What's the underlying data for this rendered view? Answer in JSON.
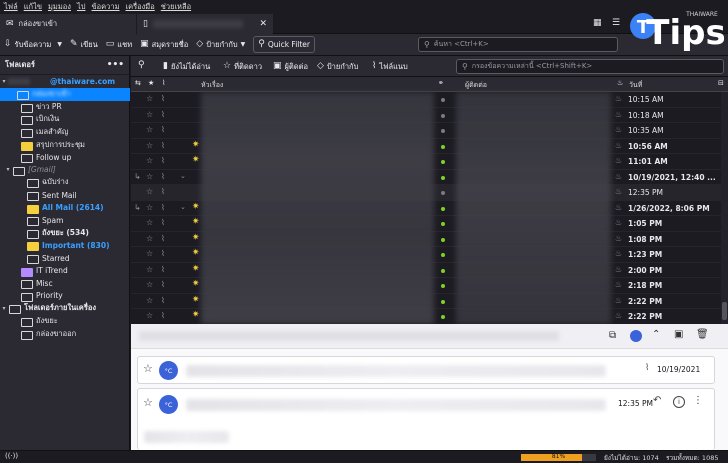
{
  "menubar": {
    "items": [
      "ไฟล์",
      "แก้ไข",
      "มุมมอง",
      "ไป",
      "ข้อความ",
      "เครื่องมือ",
      "ช่วยเหลือ"
    ]
  },
  "tabs": {
    "inbox": "กล่องขาเข้า"
  },
  "toolbar": {
    "get_messages": "รับข้อความ",
    "write": "เขียน",
    "chat": "แชท",
    "address_book": "สมุดรายชื่อ",
    "tag": "ป้ายกำกับ",
    "quick_filter": "Quick Filter",
    "search_placeholder": "ค้นหา <Ctrl+K>"
  },
  "logo": {
    "text": "Tips",
    "sub": "THAIWARE"
  },
  "sidebar": {
    "header": "โฟลเดอร์",
    "account": "@thaiware.com",
    "folders": [
      "กล่องขาเข้า",
      "ข่าว PR",
      "เบิกเงิน",
      "เมลสำคัญ",
      "สรุปการประชุม",
      "Follow up",
      "[Gmail]",
      "ฉบับร่าง",
      "Sent Mail",
      "All Mail (2614)",
      "Spam",
      "ถังขยะ (534)",
      "Important (830)",
      "Starred",
      "IT iTrend",
      "Misc",
      "Priority",
      "โฟลเดอร์ภายในเครื่อง",
      "ถังขยะ",
      "กล่องขาออก"
    ]
  },
  "quickfilter": {
    "unread": "ยังไม่ได้อ่าน",
    "starred": "ที่ติดดาว",
    "contact": "ผู้ติดต่อ",
    "tags": "ป้ายกำกับ",
    "attachment": "ไฟล์แนบ",
    "filter_placeholder": "กรองข้อความเหล่านี้ <Ctrl+Shift+K>"
  },
  "columns": {
    "subject": "หัวเรื่อง",
    "correspondents": "ผู้ติดต่อ",
    "date": "วันที่"
  },
  "messages": [
    {
      "date": "10:15 AM"
    },
    {
      "date": "10:18 AM"
    },
    {
      "date": "10:35 AM"
    },
    {
      "date": "10:56 AM"
    },
    {
      "date": "11:01 AM"
    },
    {
      "date": "10/19/2021, 12:40 ..."
    },
    {
      "date": "12:35 PM"
    },
    {
      "date": "1/26/2022, 8:06 PM"
    },
    {
      "date": "1:05 PM"
    },
    {
      "date": "1:08 PM"
    },
    {
      "date": "1:23 PM"
    },
    {
      "date": "2:00 PM"
    },
    {
      "date": "2:18 PM"
    },
    {
      "date": "2:22 PM"
    },
    {
      "date": "2:22 PM"
    }
  ],
  "reader": {
    "avatar1": "°C",
    "date1": "10/19/2021",
    "avatar2": "°C",
    "date2": "12:35 PM"
  },
  "status": {
    "progress": 0.81,
    "progress_label": "81%",
    "unread": "ยังไม่ได้อ่าน: 1074",
    "total": "รวมทั้งหมด: 1085"
  },
  "colors": {
    "accent": "#0a84ff",
    "unread_dot": "#7ed321",
    "star": "#f4d03f"
  }
}
